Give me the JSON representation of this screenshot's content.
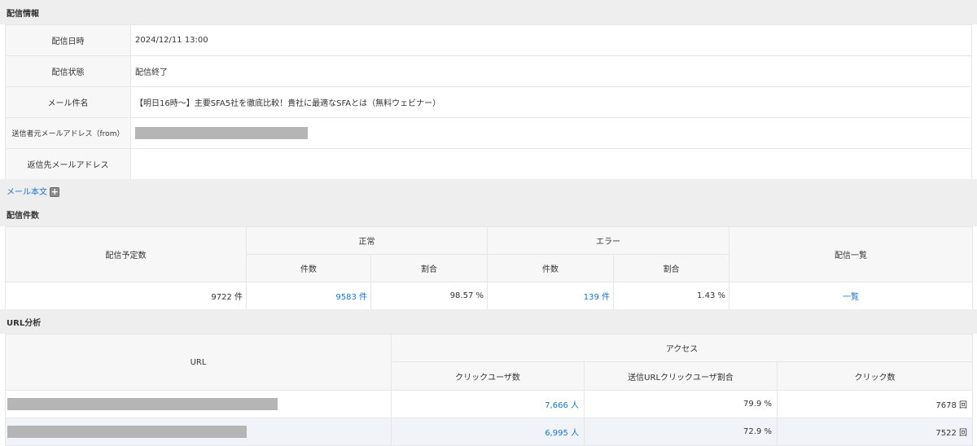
{
  "delivery_info": {
    "section_title": "配信情報",
    "rows": [
      {
        "label": "配信日時",
        "value": "2024/12/11 13:00"
      },
      {
        "label": "配信状態",
        "value": "配信終了"
      },
      {
        "label": "メール件名",
        "value": "【明日16時～】主要SFA5社を徹底比較！貴社に最適なSFAとは（無料ウェビナー）"
      },
      {
        "label": "送信者元メールアドレス（from）",
        "value": ""
      },
      {
        "label": "返信先メールアドレス",
        "value": ""
      }
    ]
  },
  "mail_body": {
    "label": "メール本文",
    "expand_icon": "plus-icon"
  },
  "delivery_count": {
    "section_title": "配信件数",
    "headers": {
      "scheduled": "配信予定数",
      "normal": "正常",
      "error": "エラー",
      "list": "配信一覧",
      "count": "件数",
      "ratio": "割合"
    },
    "row": {
      "scheduled": "9722 件",
      "normal_count": "9583 件",
      "normal_ratio": "98.57 %",
      "error_count": "139 件",
      "error_ratio": "1.43 %",
      "list_link": "一覧"
    }
  },
  "url_analysis": {
    "section_title": "URL分析",
    "headers": {
      "url": "URL",
      "access": "アクセス",
      "click_users": "クリックユーザ数",
      "click_user_ratio": "送信URLクリックユーザ割合",
      "click_count": "クリック数"
    },
    "rows": [
      {
        "url": "",
        "click_users": "7,666 人",
        "ratio": "79.9 %",
        "clicks": "7678 回"
      },
      {
        "url": "",
        "click_users": "6,995 人",
        "ratio": "72.9 %",
        "clicks": "7522 回"
      }
    ]
  },
  "colors": {
    "link": "#1a73c8",
    "section_bg": "#eeeeee",
    "header_bg": "#f7f7f7",
    "stripe_bg": "#f0f4f8"
  }
}
